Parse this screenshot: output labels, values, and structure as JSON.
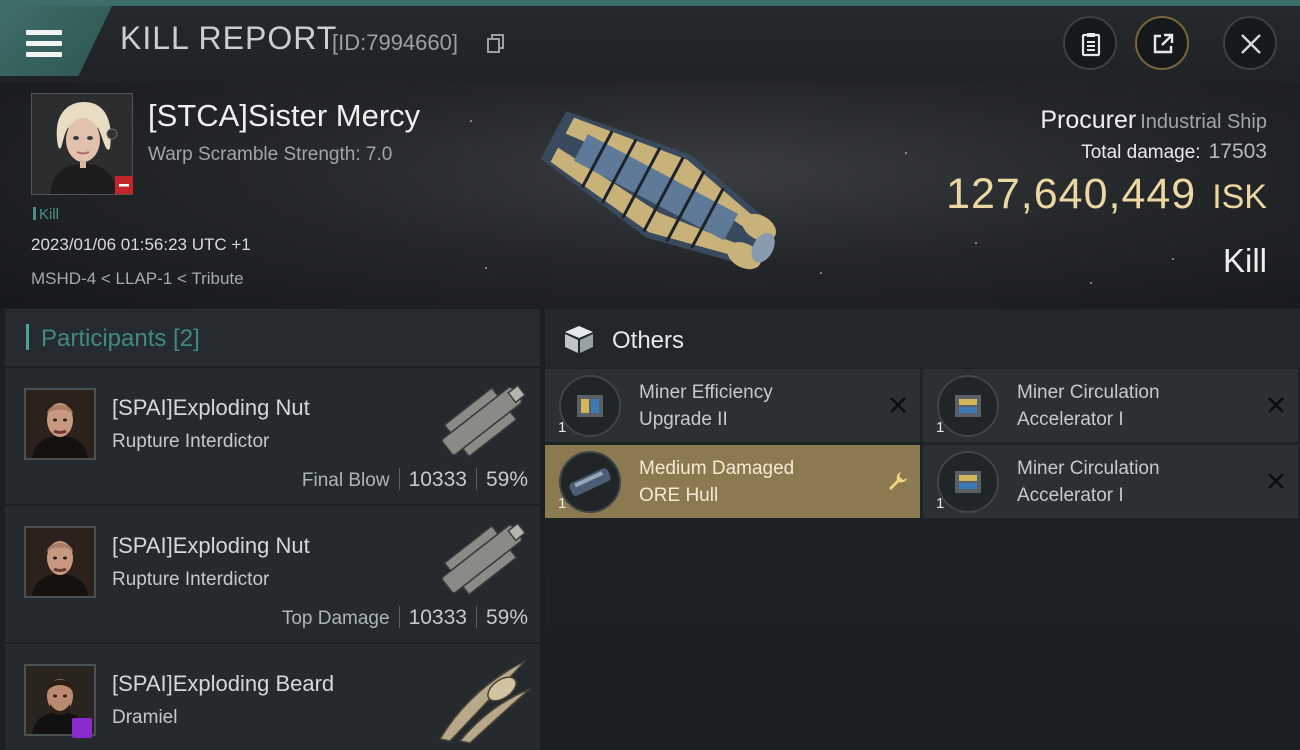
{
  "header": {
    "title": "KILL REPORT",
    "report_id": "[ID:7994660]"
  },
  "victim": {
    "name": "[STCA]Sister Mercy",
    "warp_scramble": "Warp Scramble Strength: 7.0",
    "tag": "Kill",
    "datetime": "2023/01/06 01:56:23 UTC +1",
    "location": "MSHD-4 < LLAP-1 < Tribute",
    "ship_name": "Procurer",
    "ship_class": "Industrial Ship",
    "total_damage_label": "Total damage:",
    "total_damage": "17503",
    "isk_value": "127,640,449",
    "isk_unit": "ISK",
    "result": "Kill"
  },
  "participants": {
    "title": "Participants [2]",
    "rows": [
      {
        "name": "[SPAI]Exploding Nut",
        "ship": "Rupture Interdictor",
        "role": "Final Blow",
        "damage": "10333",
        "percent": "59%"
      },
      {
        "name": "[SPAI]Exploding Nut",
        "ship": "Rupture Interdictor",
        "role": "Top Damage",
        "damage": "10333",
        "percent": "59%"
      },
      {
        "name": "[SPAI]Exploding Beard",
        "ship": "Dramiel"
      }
    ]
  },
  "others": {
    "title": "Others",
    "items": [
      {
        "name_line1": "Miner Efficiency",
        "name_line2": "Upgrade II",
        "qty": "1",
        "status": "destroyed"
      },
      {
        "name_line1": "Miner Circulation",
        "name_line2": "Accelerator I",
        "qty": "1",
        "status": "destroyed"
      },
      {
        "name_line1": "Medium Damaged",
        "name_line2": "ORE Hull",
        "qty": "1",
        "status": "dropped"
      },
      {
        "name_line1": "Miner Circulation",
        "name_line2": "Accelerator I",
        "qty": "1",
        "status": "destroyed"
      }
    ]
  },
  "colors": {
    "accent_teal": "#3f6e6a",
    "isk_gold": "#ecd6a1",
    "highlight_item": "#8b7950"
  }
}
